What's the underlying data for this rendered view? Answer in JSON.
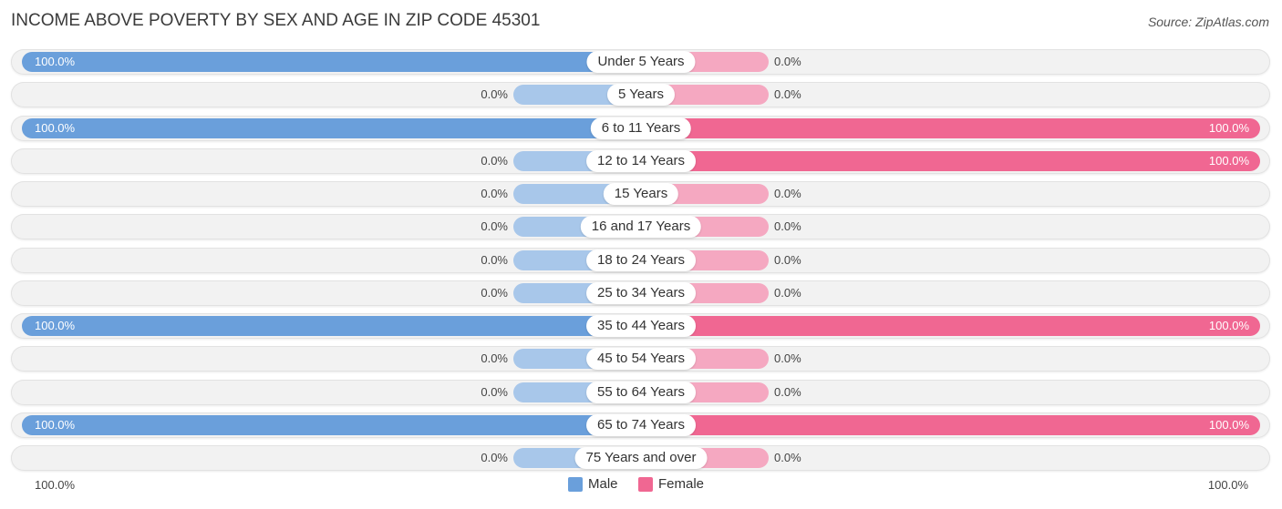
{
  "title": "INCOME ABOVE POVERTY BY SEX AND AGE IN ZIP CODE 45301",
  "source": "Source: ZipAtlas.com",
  "colors": {
    "male": "#6a9fdb",
    "male_zero": "#a8c7ea",
    "female": "#f06792",
    "female_zero": "#f5a8c1"
  },
  "legend": {
    "male": "Male",
    "female": "Female"
  },
  "axis": {
    "left": "100.0%",
    "right": "100.0%"
  },
  "chart_data": {
    "type": "bar",
    "orientation": "horizontal-diverging",
    "title": "INCOME ABOVE POVERTY BY SEX AND AGE IN ZIP CODE 45301",
    "categories": [
      "Under 5 Years",
      "5 Years",
      "6 to 11 Years",
      "12 to 14 Years",
      "15 Years",
      "16 and 17 Years",
      "18 to 24 Years",
      "25 to 34 Years",
      "35 to 44 Years",
      "45 to 54 Years",
      "55 to 64 Years",
      "65 to 74 Years",
      "75 Years and over"
    ],
    "series": [
      {
        "name": "Male",
        "values": [
          100,
          0,
          100,
          0,
          0,
          0,
          0,
          0,
          100,
          0,
          0,
          100,
          0
        ],
        "labels": [
          "100.0%",
          "0.0%",
          "100.0%",
          "0.0%",
          "0.0%",
          "0.0%",
          "0.0%",
          "0.0%",
          "100.0%",
          "0.0%",
          "0.0%",
          "100.0%",
          "0.0%"
        ]
      },
      {
        "name": "Female",
        "values": [
          0,
          0,
          100,
          100,
          0,
          0,
          0,
          0,
          100,
          0,
          0,
          100,
          0
        ],
        "labels": [
          "0.0%",
          "0.0%",
          "100.0%",
          "100.0%",
          "0.0%",
          "0.0%",
          "0.0%",
          "0.0%",
          "100.0%",
          "0.0%",
          "0.0%",
          "100.0%",
          "0.0%"
        ]
      }
    ],
    "xlim": [
      0,
      100
    ],
    "xlabel_left": "100.0%",
    "xlabel_right": "100.0%",
    "legend_position": "bottom-center",
    "grid": false
  }
}
